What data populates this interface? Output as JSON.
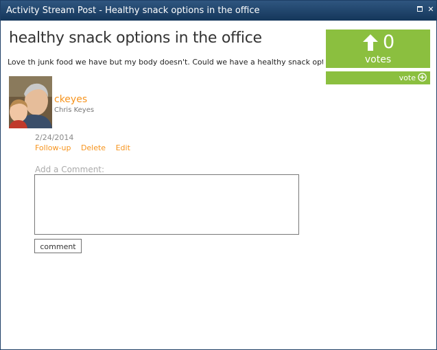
{
  "window": {
    "title": "Activity Stream Post - Healthy snack options in the office"
  },
  "post": {
    "title": "healthy snack options in the office",
    "body": "Love th junk food we have but my body doesn't.  Could we have a healthy snack options #well",
    "author_username": "ckeyes",
    "author_name": "Chris Keyes",
    "date": "2/24/2014",
    "actions": {
      "follow_up": "Follow-up",
      "delete": "Delete",
      "edit": "Edit"
    }
  },
  "votes": {
    "count": "0",
    "label": "votes",
    "vote_button_label": "vote"
  },
  "comment": {
    "label": "Add a Comment:",
    "value": "",
    "button_label": "comment"
  },
  "colors": {
    "accent_green": "#8bbf3f",
    "link_orange": "#f7941d",
    "titlebar": "#1e3f66"
  }
}
